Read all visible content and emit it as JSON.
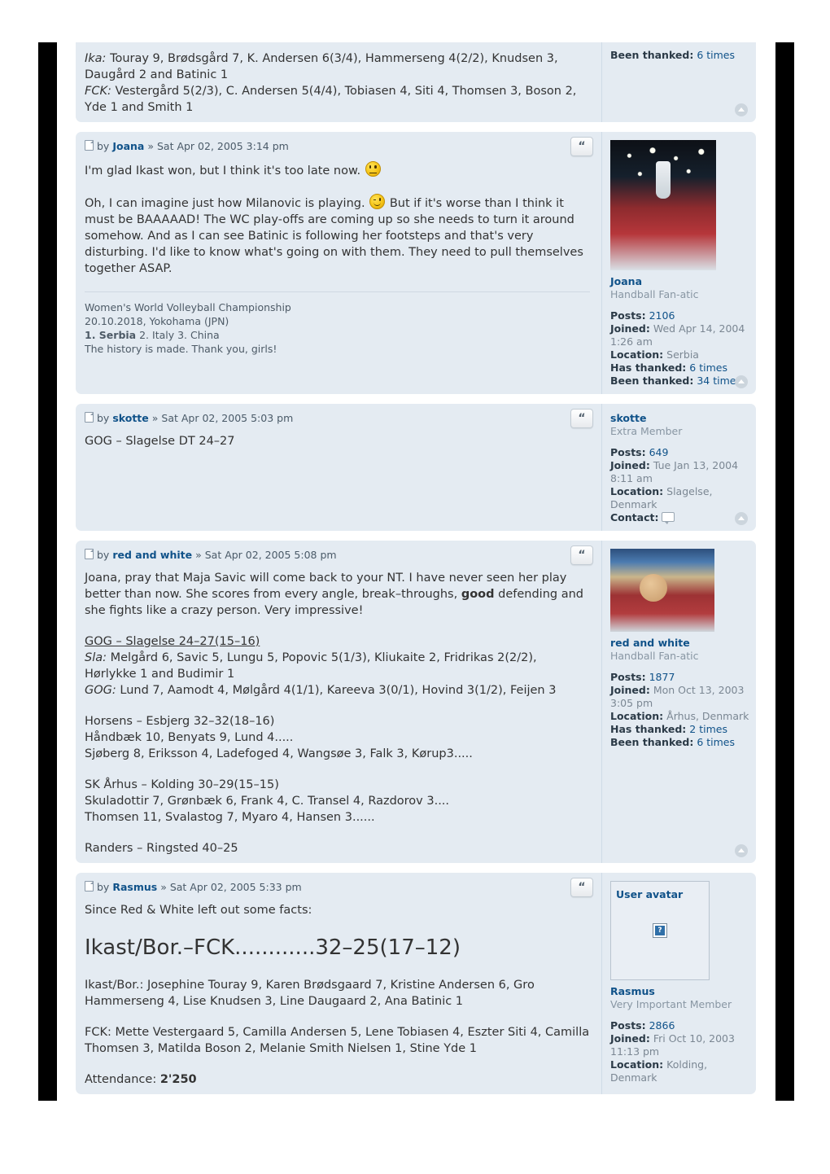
{
  "colors": {
    "post_bg": "#e4ebf2",
    "page_bg": "#ffffff",
    "link": "#105289",
    "muted": "#7b8793",
    "bar": "#000000"
  },
  "posts": [
    {
      "id": "post-truncated",
      "header": null,
      "body_lines": [
        "Ika: Touray 9, Brødsgård 7, K. Andersen 6(3/4), Hammerseng 4(2/2), Knudsen 3,",
        "Daugård 2 and Batinic 1",
        "FCK: Vestergård 5(2/3), C. Andersen 5(4/4), Tobiasen 4, Siti 4, Thomsen 3, Boson 2,",
        "Yde 1 and Smith 1"
      ],
      "body_prefix_1": "Ika:",
      "body_prefix_2": "FCK:",
      "profile": {
        "been_thanked_label": "Been thanked:",
        "been_thanked_value": "6 times"
      }
    },
    {
      "id": "post-joana",
      "header": {
        "by": "by",
        "author": "Joana",
        "sep": "»",
        "date": "Sat Apr 02, 2005 3:14 pm",
        "quote_label": "“"
      },
      "paragraph_1": "I'm glad Ikast won, but I think it's too late now.",
      "paragraph_2a": "Oh, I can imagine just how Milanovic is playing.",
      "paragraph_2b": "But if it's worse than I think it must be BAAAAAD! The WC play-offs are coming up so she needs to turn it around somehow. And as I can see Batinic is following her footsteps and that's very disturbing. I'd like to know what's going on with them. They need to pull themselves together ASAP.",
      "signature": {
        "line1": "Women's World Volleyball Championship",
        "line2": "20.10.2018, Yokohama (JPN)",
        "line3_bold": "1. Serbia",
        "line3_rest": "2. Italy 3. China",
        "line4": "The history is made. Thank you, girls!"
      },
      "profile": {
        "avatar_alt": "volleyball-team-trophy-photo",
        "name": "Joana",
        "rank": "Handball Fan-atic",
        "posts_label": "Posts:",
        "posts_value": "2106",
        "joined_label": "Joined:",
        "joined_value": "Wed Apr 14, 2004 1:26 am",
        "location_label": "Location:",
        "location_value": "Serbia",
        "has_thanked_label": "Has thanked:",
        "has_thanked_value": "6 times",
        "been_thanked_label": "Been thanked:",
        "been_thanked_value": "34 times"
      }
    },
    {
      "id": "post-skotte",
      "header": {
        "by": "by",
        "author": "skotte",
        "sep": "»",
        "date": "Sat Apr 02, 2005 5:03 pm",
        "quote_label": "“"
      },
      "paragraph_1": "GOG – Slagelse DT 24–27",
      "profile": {
        "name": "skotte",
        "rank": "Extra Member",
        "posts_label": "Posts:",
        "posts_value": "649",
        "joined_label": "Joined:",
        "joined_value": "Tue Jan 13, 2004 8:11 am",
        "location_label": "Location:",
        "location_value": "Slagelse, Denmark",
        "contact_label": "Contact:"
      }
    },
    {
      "id": "post-red-and-white",
      "header": {
        "by": "by",
        "author": "red and white",
        "sep": "»",
        "date": "Sat Apr 02, 2005 5:08 pm",
        "quote_label": "“"
      },
      "paragraph_1a": "Joana, pray that Maja Savic will come back to your NT. I have never seen her play better than now. She scores from every angle, break–throughs,",
      "paragraph_1_bold": "good",
      "paragraph_1b": "defending and she fights like a crazy person. Very impressive!",
      "match_heading": "GOG – Slagelse 24–27(15–16)",
      "match_line_sla_label": "Sla:",
      "match_line_sla": "Melgård 6, Savic 5, Lungu 5, Popovic 5(1/3), Kliukaite 2, Fridrikas 2(2/2), Hørlykke 1 and Budimir 1",
      "match_line_gog_label": "GOG:",
      "match_line_gog": "Lund 7, Aamodt 4, Mølgård 4(1/1), Kareeva 3(0/1), Hovind 3(1/2), Feijen 3",
      "block2_line1": "Horsens – Esbjerg 32–32(18–16)",
      "block2_line2": "Håndbæk 10, Benyats 9, Lund 4.....",
      "block2_line3": "Sjøberg 8, Eriksson 4, Ladefoged 4, Wangsøe 3, Falk 3, Kørup3.....",
      "block3_line1": "SK Århus – Kolding 30–29(15–15)",
      "block3_line2": "Skuladottir 7, Grønbæk 6, Frank 4, C. Transel 4, Razdorov 3....",
      "block3_line3": "Thomsen 11, Svalastog 7, Myaro 4, Hansen 3......",
      "block4_line1": "Randers – Ringsted 40–25",
      "profile": {
        "avatar_alt": "handball-player-photo",
        "name": "red and white",
        "rank": "Handball Fan-atic",
        "posts_label": "Posts:",
        "posts_value": "1877",
        "joined_label": "Joined:",
        "joined_value": "Mon Oct 13, 2003 3:05 pm",
        "location_label": "Location:",
        "location_value": "Århus, Denmark",
        "has_thanked_label": "Has thanked:",
        "has_thanked_value": "2 times",
        "been_thanked_label": "Been thanked:",
        "been_thanked_value": "6 times"
      }
    },
    {
      "id": "post-rasmus",
      "header": {
        "by": "by",
        "author": "Rasmus",
        "sep": "»",
        "date": "Sat Apr 02, 2005 5:33 pm",
        "quote_label": "“"
      },
      "paragraph_1": "Since Red & White left out some facts:",
      "big_score": "Ikast/Bor.–FCK............32–25(17–12)",
      "paragraph_2": "Ikast/Bor.: Josephine Touray 9, Karen Brødsgaard 7, Kristine Andersen 6, Gro Hammerseng 4, Lise Knudsen 3, Line Daugaard 2, Ana Batinic 1",
      "paragraph_3": "FCK: Mette Vestergaard 5, Camilla Andersen 5, Lene Tobiasen 4, Eszter Siti 4, Camilla Thomsen 3, Matilda Boson 2, Melanie Smith Nielsen 1, Stine Yde 1",
      "attendance_label": "Attendance:",
      "attendance_value": "2'250",
      "profile": {
        "avatar_placeholder": "User avatar",
        "broken_image_glyph": "?",
        "name": "Rasmus",
        "rank": "Very Important Member",
        "posts_label": "Posts:",
        "posts_value": "2866",
        "joined_label": "Joined:",
        "joined_value": "Fri Oct 10, 2003 11:13 pm",
        "location_label": "Location:",
        "location_value": "Kolding, Denmark"
      }
    }
  ]
}
